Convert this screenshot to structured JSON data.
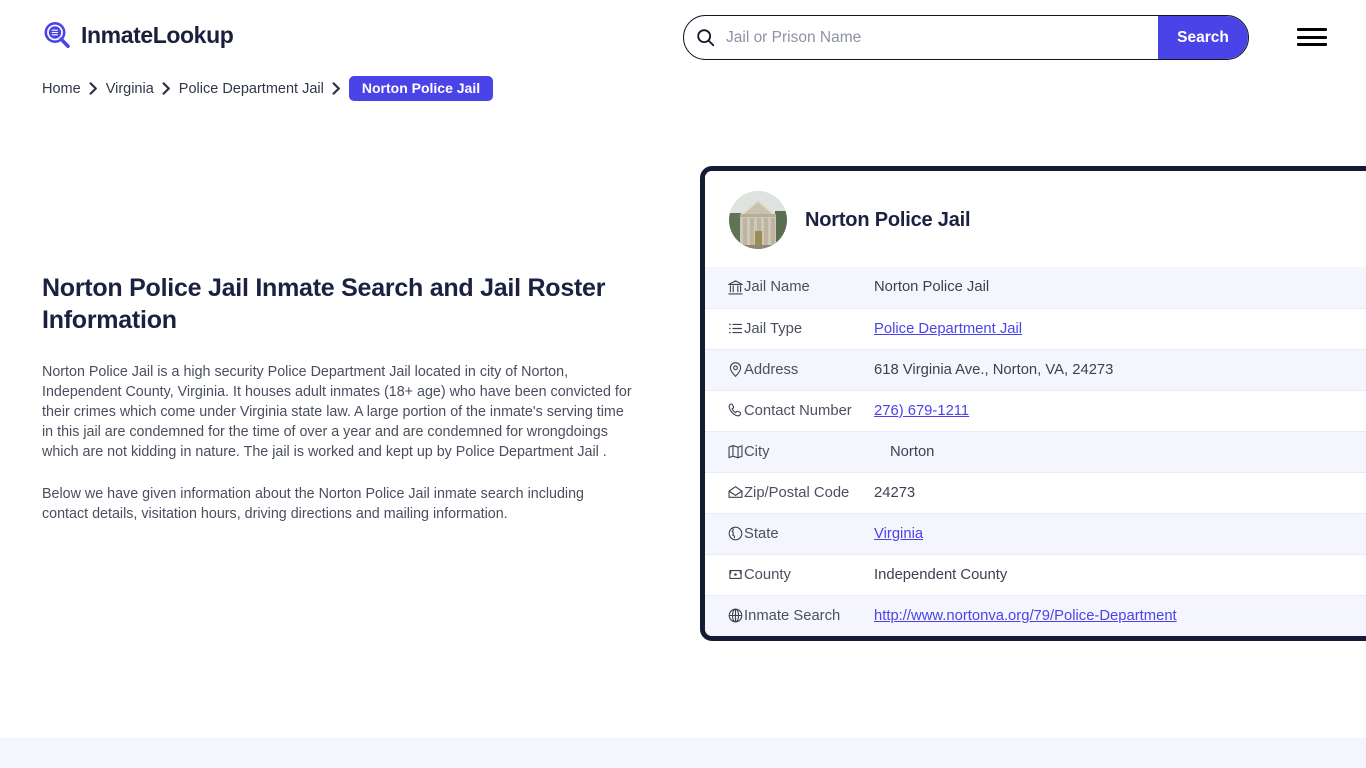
{
  "brand": {
    "name": "InmateLookup",
    "icon": "search-logo-icon"
  },
  "search": {
    "placeholder": "Jail or Prison Name",
    "value": "",
    "button_label": "Search",
    "icon": "search-icon"
  },
  "menu": {
    "icon": "hamburger-menu-icon"
  },
  "breadcrumb": {
    "items": [
      {
        "label": "Home",
        "current": false
      },
      {
        "label": "Virginia",
        "current": false
      },
      {
        "label": "Police Department Jail",
        "current": false
      },
      {
        "label": "Norton Police Jail",
        "current": true
      }
    ],
    "separator": "❯"
  },
  "main": {
    "title": "Norton Police Jail Inmate Search and Jail Roster Information",
    "paragraph_1": "Norton Police Jail is a high security Police Department Jail located in city of Norton, Independent County, Virginia. It houses adult inmates (18+ age) who have been convicted for their crimes which come under Virginia state law. A large portion of the inmate's serving time in this jail are condemned for the time of over a year and are condemned for wrongdoings which are not kidding in nature. The jail is worked and kept up by Police Department Jail .",
    "paragraph_2": "Below we have given information about the Norton Police Jail inmate search including contact details, visitation hours, driving directions and mailing information."
  },
  "card": {
    "avatar_icon": "courthouse-building-photo",
    "title": "Norton Police Jail",
    "rows": [
      {
        "icon": "bank-icon",
        "label": "Jail Name",
        "value": "Norton Police Jail",
        "link": false
      },
      {
        "icon": "list-icon",
        "label": "Jail Type",
        "value": "Police Department Jail",
        "link": true
      },
      {
        "icon": "map-pin-icon",
        "label": "Address",
        "value": "618 Virginia Ave., Norton, VA, 24273",
        "link": false
      },
      {
        "icon": "phone-icon",
        "label": "Contact Number",
        "value": "276) 679-1211",
        "link": true
      },
      {
        "icon": "map-icon",
        "label": "City",
        "value": "Norton",
        "link": false
      },
      {
        "icon": "envelope-icon",
        "label": "Zip/Postal Code",
        "value": "24273",
        "link": false
      },
      {
        "icon": "globe-americas-icon",
        "label": "State",
        "value": "Virginia",
        "link": true
      },
      {
        "icon": "county-flag-icon",
        "label": "County",
        "value": "Independent County",
        "link": false
      },
      {
        "icon": "globe-grid-icon",
        "label": "Inmate Search",
        "value": "http://www.nortonva.org/79/Police-Department",
        "link": true
      }
    ]
  },
  "colors": {
    "accent": "#4a44e8",
    "card_border": "#141c33",
    "row_alt": "#f5f5fd",
    "heading": "#1b2141",
    "body_text": "#4a4f5e",
    "footer_band": "#f5f5fd"
  }
}
